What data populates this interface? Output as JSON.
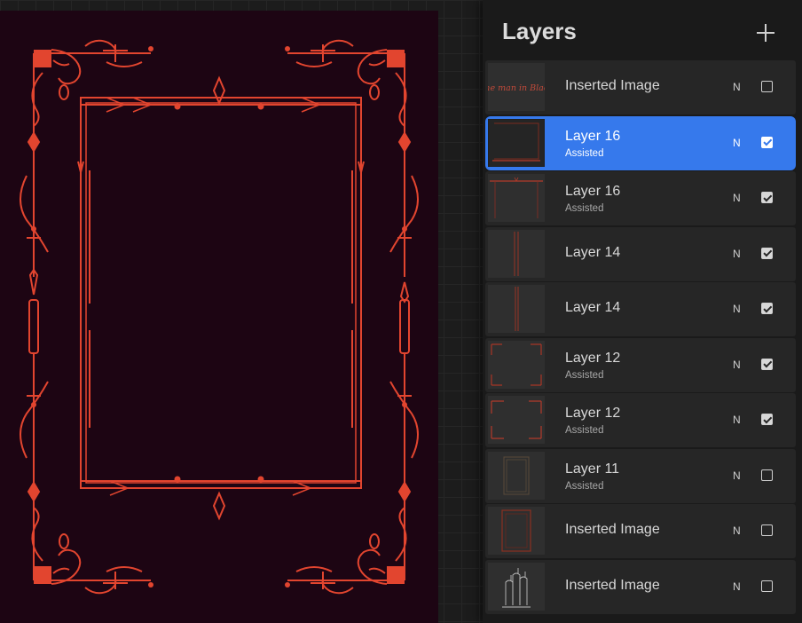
{
  "panel": {
    "title": "Layers",
    "add_icon": "plus-icon"
  },
  "colors": {
    "accent": "#3679ec",
    "frame": "#e2452f",
    "canvas_bg": "#1d0513"
  },
  "layers": [
    {
      "name": "Inserted Image",
      "sub": "",
      "blend": "N",
      "visible": false,
      "selected": false,
      "thumb_text": "The man in Black"
    },
    {
      "name": "Layer 16",
      "sub": "Assisted",
      "blend": "N",
      "visible": true,
      "selected": true,
      "thumb_text": ""
    },
    {
      "name": "Layer 16",
      "sub": "Assisted",
      "blend": "N",
      "visible": true,
      "selected": false,
      "thumb_text": ""
    },
    {
      "name": "Layer 14",
      "sub": "",
      "blend": "N",
      "visible": true,
      "selected": false,
      "thumb_text": ""
    },
    {
      "name": "Layer 14",
      "sub": "",
      "blend": "N",
      "visible": true,
      "selected": false,
      "thumb_text": ""
    },
    {
      "name": "Layer 12",
      "sub": "Assisted",
      "blend": "N",
      "visible": true,
      "selected": false,
      "thumb_text": ""
    },
    {
      "name": "Layer 12",
      "sub": "Assisted",
      "blend": "N",
      "visible": true,
      "selected": false,
      "thumb_text": ""
    },
    {
      "name": "Layer 11",
      "sub": "Assisted",
      "blend": "N",
      "visible": false,
      "selected": false,
      "thumb_text": ""
    },
    {
      "name": "Inserted Image",
      "sub": "",
      "blend": "N",
      "visible": false,
      "selected": false,
      "thumb_text": ""
    },
    {
      "name": "Inserted Image",
      "sub": "",
      "blend": "N",
      "visible": false,
      "selected": false,
      "thumb_text": ""
    }
  ]
}
